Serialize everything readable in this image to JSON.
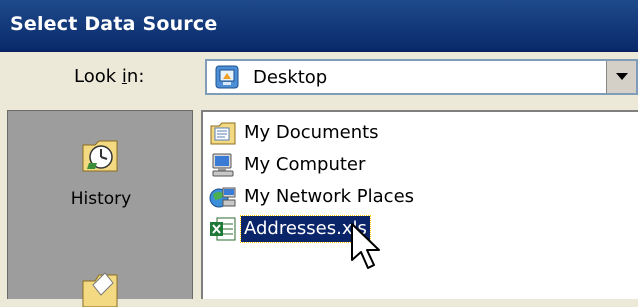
{
  "dialog": {
    "title": "Select Data Source"
  },
  "lookin": {
    "label_prefix": "Look ",
    "label_mnemonic": "i",
    "label_suffix": "n:",
    "value": "Desktop"
  },
  "places": [
    {
      "label": "History",
      "icon": "history-icon"
    },
    {
      "label": "",
      "icon": "folder-icon"
    }
  ],
  "files": [
    {
      "name": "My Documents",
      "icon": "my-documents-icon",
      "selected": false
    },
    {
      "name": "My Computer",
      "icon": "my-computer-icon",
      "selected": false
    },
    {
      "name": "My Network Places",
      "icon": "network-places-icon",
      "selected": false
    },
    {
      "name": "Addresses.xls",
      "icon": "excel-file-icon",
      "selected": true
    }
  ],
  "colors": {
    "titlebar": "#0a246a",
    "selection": "#0a246a",
    "dialog_bg": "#ece9d8"
  }
}
